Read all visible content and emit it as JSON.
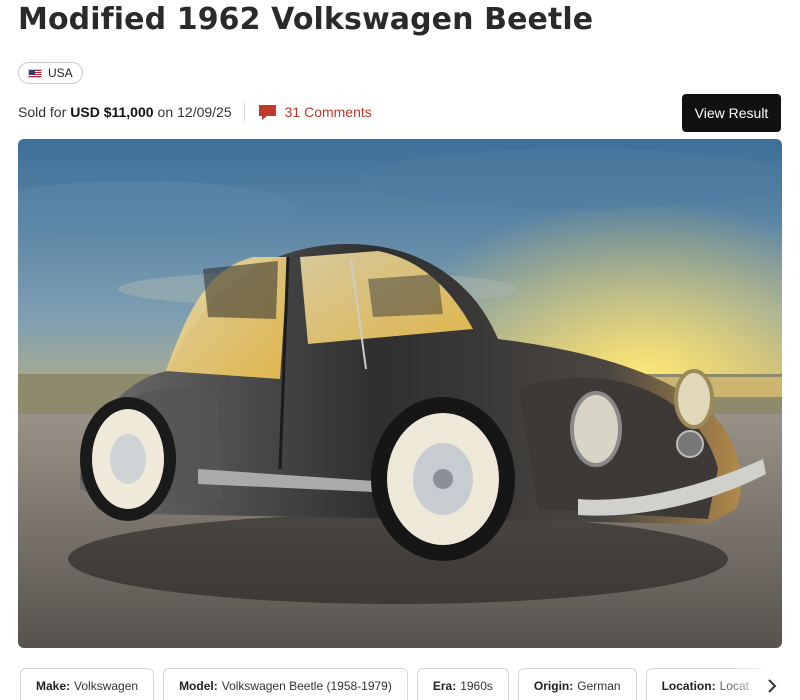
{
  "listing": {
    "title": "Modified 1962 Volkswagen Beetle",
    "country": "USA",
    "sold_prefix": "Sold for",
    "price": "USD $11,000",
    "date_prefix": "on",
    "date": "12/09/25",
    "comments_label": "31 Comments",
    "view_result_label": "View Result"
  },
  "hero_image": {
    "alt": "Modified 1962 Volkswagen Beetle"
  },
  "specs": [
    {
      "label": "Make:",
      "value": "Volkswagen"
    },
    {
      "label": "Model:",
      "value": "Volkswagen Beetle (1958-1979)"
    },
    {
      "label": "Era:",
      "value": "1960s"
    },
    {
      "label": "Origin:",
      "value": "German"
    },
    {
      "label": "Location:",
      "value": "Locat"
    }
  ],
  "icons": {
    "flag": "us-flag-icon",
    "comments": "comment-icon",
    "next": "chevron-right-icon"
  },
  "colors": {
    "accent": "#c0392b",
    "button_bg": "#111111"
  }
}
